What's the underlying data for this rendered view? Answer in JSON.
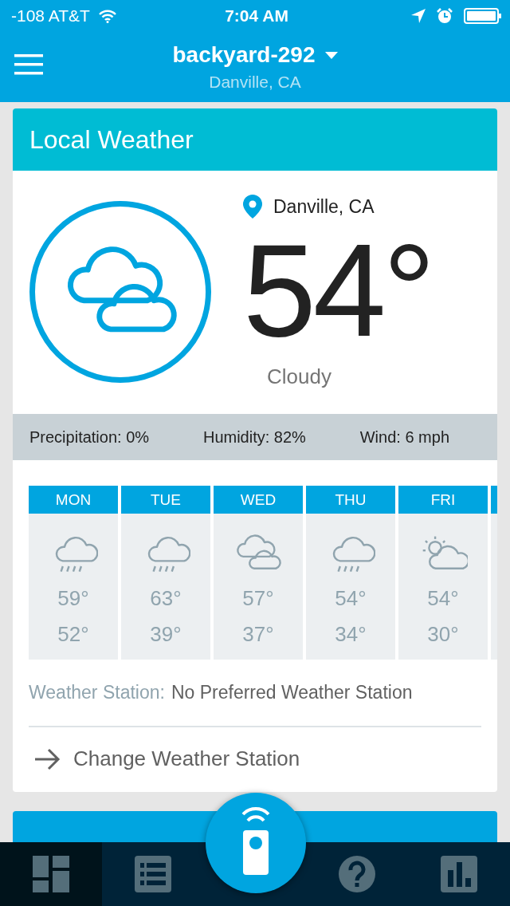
{
  "status_bar": {
    "carrier": "-108 AT&T",
    "time": "7:04 AM"
  },
  "header": {
    "title": "backyard-292",
    "subtitle": "Danville, CA"
  },
  "weather_card": {
    "title": "Local Weather",
    "condition_icon": {
      "kind": "cloudy"
    },
    "location": "Danville, CA",
    "temperature": "54°",
    "condition": "Cloudy",
    "stats": [
      "Precipitation: 0%",
      "Humidity: 82%",
      "Wind: 6 mph"
    ],
    "forecast": [
      {
        "day": "MON",
        "kind": "rain",
        "high": "59°",
        "low": "52°"
      },
      {
        "day": "TUE",
        "kind": "rain",
        "high": "63°",
        "low": "39°"
      },
      {
        "day": "WED",
        "kind": "cloudy",
        "high": "57°",
        "low": "37°"
      },
      {
        "day": "THU",
        "kind": "rain",
        "high": "54°",
        "low": "34°"
      },
      {
        "day": "FRI",
        "kind": "partly-sunny",
        "high": "54°",
        "low": "30°"
      }
    ],
    "station_label": "Weather Station:",
    "station_value": "No Preferred Weather Station",
    "change_link": "Change Weather Station"
  },
  "bottom_nav": [
    {
      "kind": "dashboard",
      "selected": true
    },
    {
      "kind": "list",
      "selected": false
    },
    {
      "kind": "remote",
      "selected": false
    },
    {
      "kind": "help",
      "selected": false
    },
    {
      "kind": "chart",
      "selected": false
    }
  ]
}
